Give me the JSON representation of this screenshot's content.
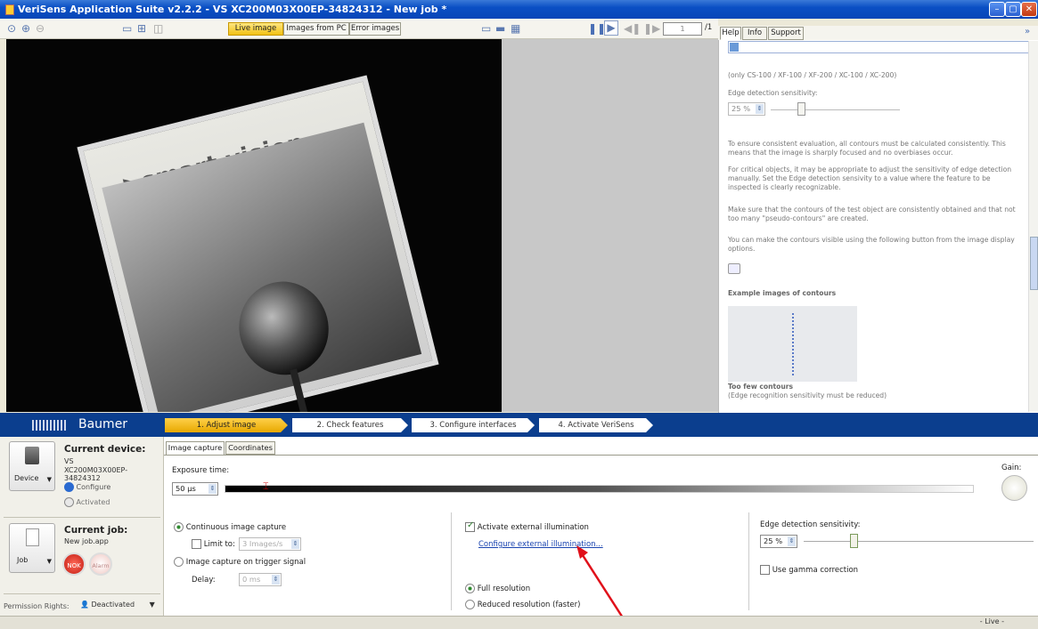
{
  "window": {
    "title": "VeriSens Application Suite v2.2.2 - VS XC200M03X00EP-34824312 - New job *",
    "buttons": [
      "minimize",
      "maximize",
      "close"
    ]
  },
  "toolbar": {
    "view_tabs": [
      {
        "label": "Live image",
        "active": true
      },
      {
        "label": "Images from PC",
        "active": false
      },
      {
        "label": "Error images",
        "active": false
      }
    ],
    "page_value": "1",
    "page_total": "/1"
  },
  "help_tabs": [
    {
      "label": "Help",
      "active": true
    },
    {
      "label": "Info",
      "active": false
    },
    {
      "label": "Support",
      "active": false
    }
  ],
  "help": {
    "applies_to": "(only CS-100 / XF-100 / XF-200 / XC-100 / XC-200)",
    "sensitivity_label": "Edge detection sensitivity:",
    "sensitivity_value": "25 %",
    "para1": "To ensure consistent evaluation, all contours must be calculated consistently. This means that the image is sharply focused and no overbiases occur.",
    "para2": "For critical objects, it may be appropriate to adjust the sensitivity of edge detection manually. Set the Edge detection sensivity to a value where the feature to be inspected is clearly recognizable.",
    "para3": "Make sure that the contours of the test object are consistently obtained and that not too many \"pseudo-contours\" are created.",
    "para4": "You can make the contours visible using the following button from the image display options.",
    "examples_heading": "Example images of contours",
    "caption_title": "Too few contours",
    "caption_sub": "(Edge recognition sensitivity must be reduced)"
  },
  "image": {
    "sign_text": "smart vision lights"
  },
  "brand": "Baumer",
  "steps": [
    {
      "label": "1. Adjust image",
      "active": true
    },
    {
      "label": "2. Check features",
      "active": false
    },
    {
      "label": "3. Configure interfaces",
      "active": false
    },
    {
      "label": "4. Activate VeriSens",
      "active": false
    }
  ],
  "device": {
    "title": "Current device:",
    "model_prefix": "VS",
    "model": "XC200M03X00EP-34824312",
    "button": "Device",
    "configure": "Configure",
    "activated": "Activated"
  },
  "job": {
    "title": "Current job:",
    "file": "New job.app",
    "button": "Job",
    "nok": "NOK",
    "alarm": "Alarm"
  },
  "permission": {
    "label": "Permission Rights:",
    "value": "Deactivated"
  },
  "capture_tabs": [
    {
      "label": "Image capture",
      "active": true
    },
    {
      "label": "Coordinates",
      "active": false
    }
  ],
  "capture": {
    "exposure_label": "Exposure time:",
    "exposure_value": "50 µs",
    "gain_label": "Gain:",
    "continuous": "Continuous image capture",
    "limit_label": "Limit to:",
    "limit_value": "3 Images/s",
    "trigger": "Image capture on trigger signal",
    "delay_label": "Delay:",
    "delay_value": "0 ms",
    "ext_illum": "Activate external illumination",
    "configure_link": "Configure external illumination...",
    "full_res": "Full resolution",
    "reduced_res": "Reduced resolution (faster)",
    "edge_label": "Edge detection sensitivity:",
    "edge_value": "25 %",
    "gamma": "Use gamma correction"
  },
  "status": {
    "live": "- Live -"
  }
}
